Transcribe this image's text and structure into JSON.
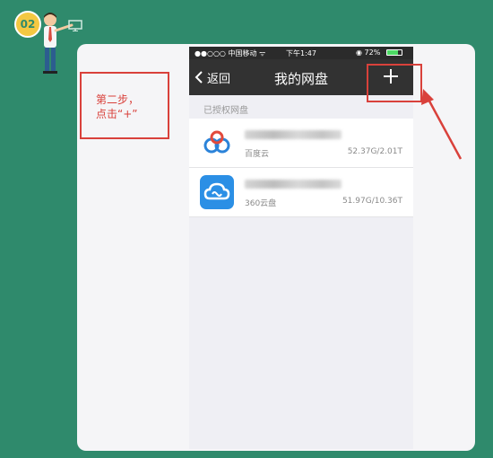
{
  "tutorial": {
    "step_number": "02",
    "annotation": "第二步，\n点击“+”"
  },
  "status_bar": {
    "carrier": "●●○○○ 中国移动 ᯤ",
    "time": "下午1:47",
    "battery": "◉ 72%",
    "battery_level": 0.72
  },
  "nav": {
    "back_label": "返回",
    "title": "我的网盘",
    "add_icon": "plus-icon"
  },
  "section": {
    "label": "已授权网盘"
  },
  "storage_list": [
    {
      "service": "百度云",
      "usage": "52.37G/2.01T",
      "icon": "baidu-cloud-icon"
    },
    {
      "service": "360云盘",
      "usage": "51.97G/10.36T",
      "icon": "360-cloud-icon"
    }
  ],
  "colors": {
    "background": "#2f8a6c",
    "annotation_red": "#d9413b",
    "nav_dark": "#323232",
    "baidu_blue": "#2b83d9",
    "cloud360_blue": "#2b8fe5"
  }
}
